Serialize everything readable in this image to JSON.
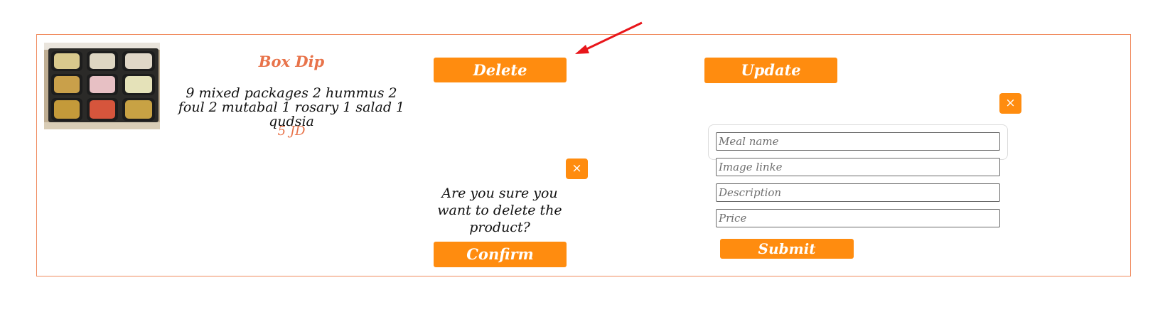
{
  "product": {
    "name": "Box Dip",
    "description": "9 mixed packages 2 hummus 2 foul 2 mutabal 1 rosary 1 salad 1 qudsia",
    "price": "5 JD",
    "image_alt": "Box Dip"
  },
  "actions": {
    "delete_label": "Delete",
    "update_label": "Update"
  },
  "delete_dialog": {
    "close_label": "×",
    "message": "Are you sure you want to delete the product?",
    "confirm_label": "Confirm"
  },
  "update_form": {
    "close_label": "×",
    "meal_name_placeholder": "Meal name",
    "image_link_placeholder": "Image linke",
    "description_placeholder": "Description",
    "price_placeholder": "Price",
    "submit_label": "Submit"
  },
  "colors": {
    "accent": "#ff8c0f",
    "heading": "#e8734a",
    "card_border": "#f08a5d",
    "annotation": "#e8161b"
  }
}
